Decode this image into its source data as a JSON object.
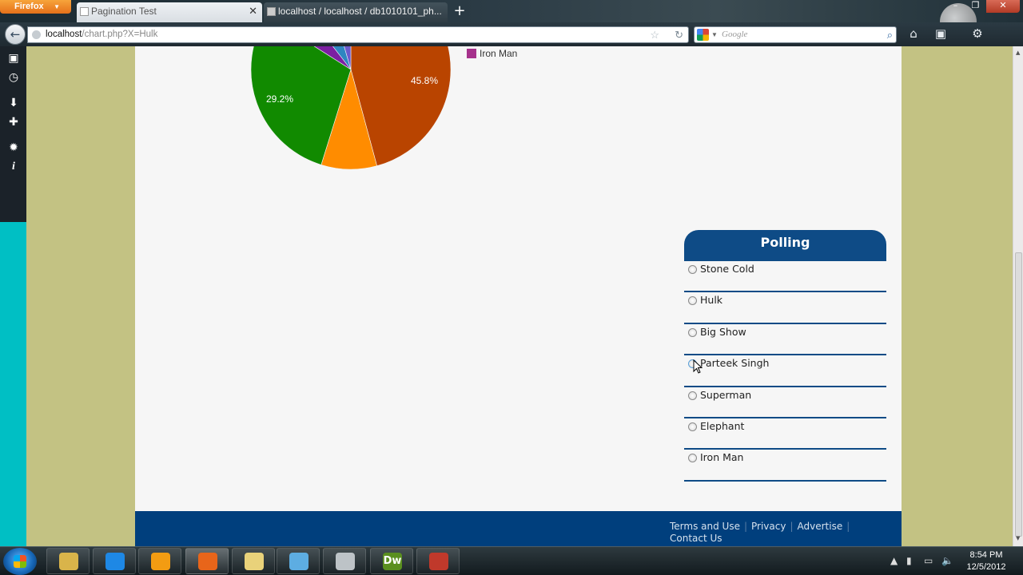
{
  "browser": {
    "app_button": "Firefox",
    "tabs": [
      {
        "title": "Pagination Test",
        "active": false
      },
      {
        "title": "localhost / localhost / db1010101_ph...",
        "active": true
      }
    ],
    "new_tab": "+",
    "window_controls": {
      "minimize": "–",
      "maximize": "❐",
      "close": "✕"
    },
    "url": {
      "host": "localhost",
      "path": "/chart.php?X=Hulk"
    },
    "search": {
      "placeholder": "Google"
    }
  },
  "chart_data": {
    "type": "pie",
    "slices_labeled": [
      {
        "label": "45.8%",
        "value": 45.8,
        "color": "#b94400"
      },
      {
        "label": "29.2%",
        "value": 29.2,
        "color": "#118a00"
      }
    ],
    "other_visible_slice_colors": [
      "#ff8c00",
      "#7b1fa2",
      "#2e86c1",
      "#6a5acd"
    ],
    "legend": [
      {
        "label": "Iron Man",
        "color": "#a6328c"
      }
    ]
  },
  "poll": {
    "title": "Polling",
    "options": [
      "Stone Cold",
      "Hulk",
      "Big Show",
      "Parteek Singh",
      "Superman",
      "Elephant",
      "Iron Man"
    ],
    "hovered_index": 3
  },
  "footer": {
    "links": [
      "Terms and Use",
      "Privacy",
      "Advertise",
      "Contact Us"
    ],
    "separator": "|"
  },
  "taskbar": {
    "time": "8:54 PM",
    "date": "12/5/2012",
    "apps": [
      {
        "icon": "explorer-icon",
        "color": "#d9b44a"
      },
      {
        "icon": "internet-explorer-icon",
        "color": "#1e88e5"
      },
      {
        "icon": "media-player-icon",
        "color": "#f39c12"
      },
      {
        "icon": "firefox-icon",
        "color": "#e8651a"
      },
      {
        "icon": "folder-icon",
        "color": "#e9d27a"
      },
      {
        "icon": "network-app-icon",
        "color": "#5dade2"
      },
      {
        "icon": "phone-app-icon",
        "color": "#bdc3c7"
      },
      {
        "icon": "dreamweaver-icon",
        "color": "#5a8f1f",
        "text": "Dw"
      },
      {
        "icon": "media-app-icon",
        "color": "#c0392b"
      }
    ]
  },
  "colors": {
    "accent_blue": "#0e4b86",
    "footer_blue": "#003f7d",
    "page_olive": "#c3c283",
    "sidebar_teal": "#00bfc4"
  }
}
